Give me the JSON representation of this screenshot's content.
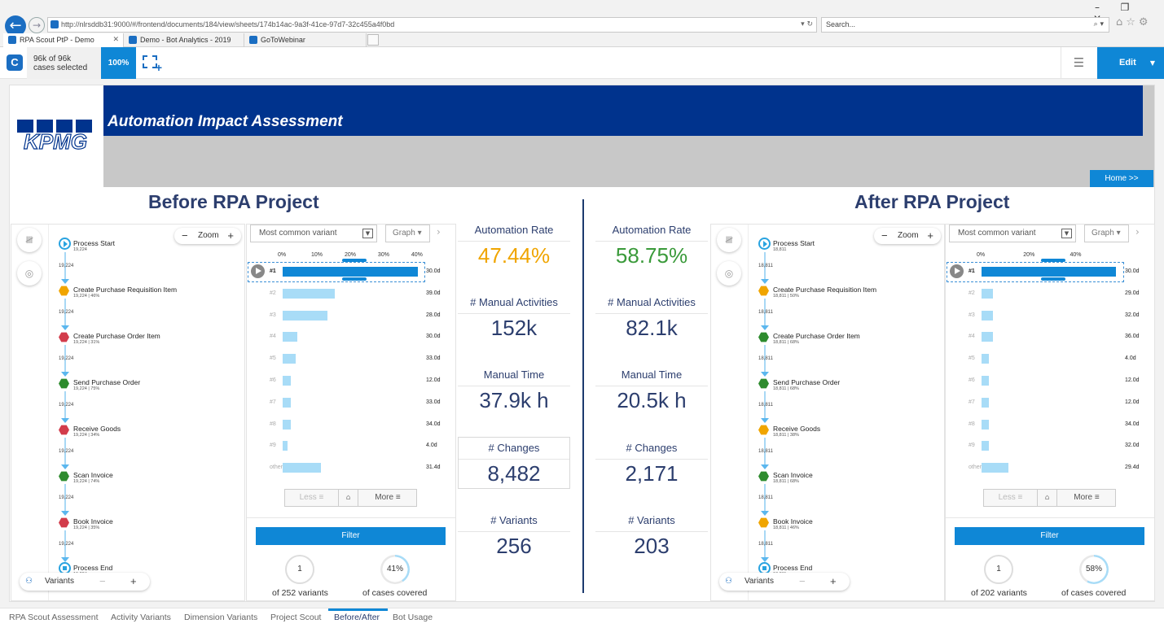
{
  "browser": {
    "url": "http://nlrsddb31:9000/#/frontend/documents/184/view/sheets/174b14ac-9a3f-41ce-97d7-32c455a4f0bd",
    "search_placeholder": "Search...",
    "tabs": [
      {
        "label": "RPA Scout PtP - Demo",
        "active": true
      },
      {
        "label": "Demo - Bot Analytics - 2019",
        "active": false
      },
      {
        "label": "GoToWebinar",
        "active": false
      }
    ]
  },
  "app": {
    "cases_line1": "96k of 96k",
    "cases_line2": "cases selected",
    "cases_pct": "100%",
    "edit_label": "Edit"
  },
  "banner": {
    "logo_text": "KPMG",
    "title": "Automation Impact Assessment",
    "home_label": "Home >>"
  },
  "before": {
    "title": "Before RPA Project",
    "zoom_label": "Zoom",
    "variants_label": "Variants",
    "process_nodes": [
      {
        "name": "Process Start",
        "sub": "19,224",
        "kind": "start"
      },
      {
        "name": "Create Purchase Requisition Item",
        "sub": "19,224 | 46%",
        "kind": "hex",
        "color": "#f0a500"
      },
      {
        "name": "Create Purchase Order Item",
        "sub": "19,224 | 31%",
        "kind": "hex",
        "color": "#d23c4b"
      },
      {
        "name": "Send Purchase Order",
        "sub": "19,224 | 75%",
        "kind": "hex",
        "color": "#2e8b2e"
      },
      {
        "name": "Receive Goods",
        "sub": "19,224 | 34%",
        "kind": "hex",
        "color": "#d23c4b"
      },
      {
        "name": "Scan Invoice",
        "sub": "19,224 | 74%",
        "kind": "hex",
        "color": "#2e8b2e"
      },
      {
        "name": "Book Invoice",
        "sub": "19,224 | 35%",
        "kind": "hex",
        "color": "#d23c4b"
      },
      {
        "name": "Process End",
        "sub": "19,224",
        "kind": "end"
      }
    ],
    "edge_labels": [
      "19,224",
      "19,224",
      "19,224",
      "19,224",
      "19,224",
      "19,224",
      "19,224"
    ],
    "variant_select": "Most common variant",
    "graph_label": "Graph",
    "chart": {
      "ticks": [
        "0%",
        "10%",
        "20%",
        "30%",
        "40%"
      ],
      "rows": [
        {
          "label": "#1",
          "value": 40.5,
          "duration": "30.0d",
          "selected": true
        },
        {
          "label": "#2",
          "value": 15.5,
          "duration": "39.0d"
        },
        {
          "label": "#3",
          "value": 13.5,
          "duration": "28.0d"
        },
        {
          "label": "#4",
          "value": 4.5,
          "duration": "30.0d"
        },
        {
          "label": "#5",
          "value": 4.0,
          "duration": "33.0d"
        },
        {
          "label": "#6",
          "value": 2.5,
          "duration": "12.0d"
        },
        {
          "label": "#7",
          "value": 2.5,
          "duration": "33.0d"
        },
        {
          "label": "#8",
          "value": 2.5,
          "duration": "34.0d"
        },
        {
          "label": "#9",
          "value": 1.5,
          "duration": "4.0d"
        },
        {
          "label": "others",
          "value": 11.5,
          "duration": "31.4d"
        }
      ]
    },
    "less_label": "Less",
    "more_label": "More",
    "filter_label": "Filter",
    "donut_count": "1",
    "donut_count_label": "of 252 variants",
    "donut_pct": "41%",
    "donut_pct_value": 0.41,
    "donut_pct_label": "of cases covered",
    "kpis": [
      {
        "title": "Automation Rate",
        "value": "47.44%",
        "color": "#f0a500"
      },
      {
        "title": "# Manual Activities",
        "value": "152k"
      },
      {
        "title": "Manual Time",
        "value": "37.9k h"
      },
      {
        "title": "# Changes",
        "value": "8,482"
      },
      {
        "title": "# Variants",
        "value": "256"
      }
    ]
  },
  "after": {
    "title": "After RPA Project",
    "zoom_label": "Zoom",
    "variants_label": "Variants",
    "process_nodes": [
      {
        "name": "Process Start",
        "sub": "18,811",
        "kind": "start"
      },
      {
        "name": "Create Purchase Requisition Item",
        "sub": "18,811 | 50%",
        "kind": "hex",
        "color": "#f0a500"
      },
      {
        "name": "Create Purchase Order Item",
        "sub": "18,811 | 68%",
        "kind": "hex",
        "color": "#2e8b2e"
      },
      {
        "name": "Send Purchase Order",
        "sub": "18,811 | 68%",
        "kind": "hex",
        "color": "#2e8b2e"
      },
      {
        "name": "Receive Goods",
        "sub": "18,811 | 38%",
        "kind": "hex",
        "color": "#f0a500"
      },
      {
        "name": "Scan Invoice",
        "sub": "18,811 | 68%",
        "kind": "hex",
        "color": "#2e8b2e"
      },
      {
        "name": "Book Invoice",
        "sub": "18,811 | 46%",
        "kind": "hex",
        "color": "#f0a500"
      },
      {
        "name": "Process End",
        "sub": "18,811",
        "kind": "end"
      }
    ],
    "edge_labels": [
      "18,811",
      "18,811",
      "18,811",
      "18,811",
      "18,811",
      "18,811",
      "18,811"
    ],
    "variant_select": "Most common variant",
    "graph_label": "Graph",
    "chart": {
      "ticks": [
        "0%",
        "20%",
        "40%"
      ],
      "rows": [
        {
          "label": "#1",
          "value": 57.5,
          "duration": "30.0d",
          "selected": true
        },
        {
          "label": "#2",
          "value": 5.0,
          "duration": "29.0d"
        },
        {
          "label": "#3",
          "value": 5.0,
          "duration": "32.0d"
        },
        {
          "label": "#4",
          "value": 5.0,
          "duration": "36.0d"
        },
        {
          "label": "#5",
          "value": 3.0,
          "duration": "4.0d"
        },
        {
          "label": "#6",
          "value": 3.0,
          "duration": "12.0d"
        },
        {
          "label": "#7",
          "value": 3.0,
          "duration": "12.0d"
        },
        {
          "label": "#8",
          "value": 3.0,
          "duration": "34.0d"
        },
        {
          "label": "#9",
          "value": 3.0,
          "duration": "32.0d"
        },
        {
          "label": "others",
          "value": 11.5,
          "duration": "29.4d"
        }
      ]
    },
    "less_label": "Less",
    "more_label": "More",
    "filter_label": "Filter",
    "donut_count": "1",
    "donut_count_label": "of 202 variants",
    "donut_pct": "58%",
    "donut_pct_value": 0.58,
    "donut_pct_label": "of cases covered",
    "kpis": [
      {
        "title": "Automation Rate",
        "value": "58.75%",
        "color": "#3a9a3a"
      },
      {
        "title": "# Manual Activities",
        "value": "82.1k"
      },
      {
        "title": "Manual Time",
        "value": "20.5k h"
      },
      {
        "title": "# Changes",
        "value": "2,171"
      },
      {
        "title": "# Variants",
        "value": "203"
      }
    ]
  },
  "sheet_tabs": [
    {
      "label": "RPA Scout Assessment",
      "active": false
    },
    {
      "label": "Activity Variants",
      "active": false
    },
    {
      "label": "Dimension Variants",
      "active": false
    },
    {
      "label": "Project Scout",
      "active": false
    },
    {
      "label": "Before/After",
      "active": true
    },
    {
      "label": "Bot Usage",
      "active": false
    }
  ]
}
